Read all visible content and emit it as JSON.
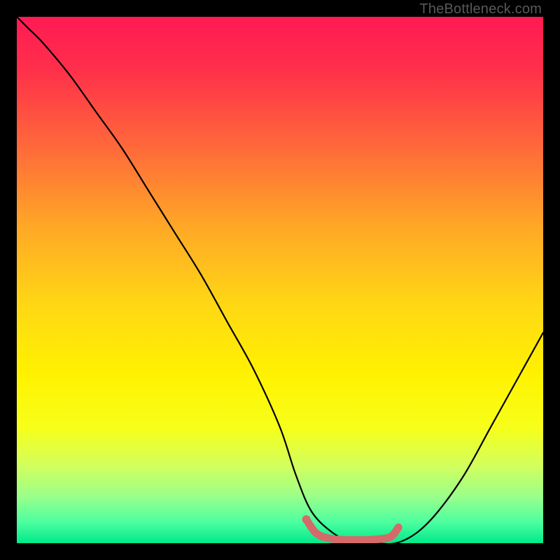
{
  "attribution": "TheBottleneck.com",
  "chart_data": {
    "type": "line",
    "title": "",
    "xlabel": "",
    "ylabel": "",
    "xlim": [
      0,
      100
    ],
    "ylim": [
      0,
      100
    ],
    "gradient_stops": [
      {
        "offset": 0.0,
        "color": "#ff1a54"
      },
      {
        "offset": 0.1,
        "color": "#ff2f4a"
      },
      {
        "offset": 0.25,
        "color": "#ff6a3a"
      },
      {
        "offset": 0.4,
        "color": "#ffa826"
      },
      {
        "offset": 0.55,
        "color": "#ffd814"
      },
      {
        "offset": 0.68,
        "color": "#fff200"
      },
      {
        "offset": 0.78,
        "color": "#f7ff1a"
      },
      {
        "offset": 0.85,
        "color": "#d4ff5a"
      },
      {
        "offset": 0.91,
        "color": "#9cff8a"
      },
      {
        "offset": 0.96,
        "color": "#4cffa0"
      },
      {
        "offset": 1.0,
        "color": "#00e98a"
      }
    ],
    "series": [
      {
        "name": "bottleneck-curve",
        "x": [
          0,
          2,
          5,
          10,
          15,
          20,
          25,
          30,
          35,
          40,
          45,
          50,
          53,
          56,
          60,
          64,
          68,
          72,
          76,
          80,
          85,
          90,
          95,
          100
        ],
        "y": [
          100,
          98,
          95,
          89,
          82,
          75,
          67,
          59,
          51,
          42,
          33,
          22,
          13,
          6,
          2,
          0,
          0,
          0,
          2,
          6,
          13,
          22,
          31,
          40
        ]
      }
    ],
    "highlight_band": {
      "name": "optimal-range",
      "color": "#d46a6a",
      "x": [
        55,
        57,
        60,
        64,
        68,
        71,
        72.5
      ],
      "y": [
        4.5,
        1.8,
        0.8,
        0.6,
        0.7,
        1.2,
        3.0
      ]
    }
  }
}
